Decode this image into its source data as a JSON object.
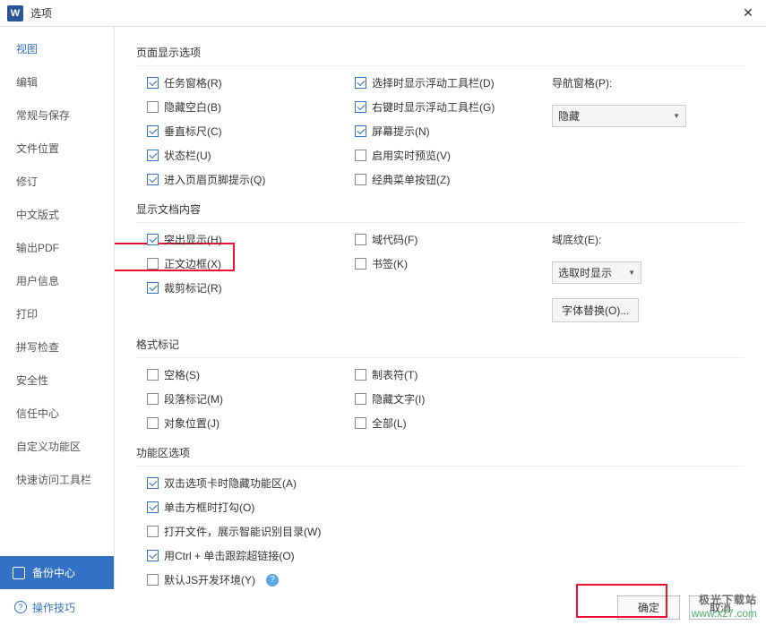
{
  "titlebar": {
    "icon": "W",
    "title": "选项",
    "close": "✕"
  },
  "sidebar": {
    "items": [
      "视图",
      "编辑",
      "常规与保存",
      "文件位置",
      "修订",
      "中文版式",
      "输出PDF",
      "用户信息",
      "打印",
      "拼写检查",
      "安全性",
      "信任中心",
      "自定义功能区",
      "快速访问工具栏"
    ],
    "backup": "备份中心"
  },
  "sections": {
    "page_display": {
      "title": "页面显示选项",
      "col1": [
        {
          "label": "任务窗格(R)",
          "checked": true
        },
        {
          "label": "隐藏空白(B)",
          "checked": false
        },
        {
          "label": "垂直标尺(C)",
          "checked": true
        },
        {
          "label": "状态栏(U)",
          "checked": true
        },
        {
          "label": "进入页眉页脚提示(Q)",
          "checked": true
        }
      ],
      "col2": [
        {
          "label": "选择时显示浮动工具栏(D)",
          "checked": true
        },
        {
          "label": "右键时显示浮动工具栏(G)",
          "checked": true
        },
        {
          "label": "屏幕提示(N)",
          "checked": true
        },
        {
          "label": "启用实时预览(V)",
          "checked": false
        },
        {
          "label": "经典菜单按钮(Z)",
          "checked": false
        }
      ],
      "nav_label": "导航窗格(P):",
      "nav_value": "隐藏"
    },
    "doc_content": {
      "title": "显示文档内容",
      "col1": [
        {
          "label": "突出显示(H)",
          "checked": true
        },
        {
          "label": "正文边框(X)",
          "checked": false
        },
        {
          "label": "裁剪标记(R)",
          "checked": true
        }
      ],
      "col2": [
        {
          "label": "域代码(F)",
          "checked": false
        },
        {
          "label": "书签(K)",
          "checked": false
        }
      ],
      "shade_label": "域底纹(E):",
      "shade_value": "选取时显示",
      "font_btn": "字体替换(O)..."
    },
    "format_marks": {
      "title": "格式标记",
      "col1": [
        {
          "label": "空格(S)",
          "checked": false
        },
        {
          "label": "段落标记(M)",
          "checked": false
        },
        {
          "label": "对象位置(J)",
          "checked": false
        }
      ],
      "col2": [
        {
          "label": "制表符(T)",
          "checked": false
        },
        {
          "label": "隐藏文字(I)",
          "checked": false
        },
        {
          "label": "全部(L)",
          "checked": false
        }
      ]
    },
    "ribbon": {
      "title": "功能区选项",
      "items": [
        {
          "label": "双击选项卡时隐藏功能区(A)",
          "checked": true
        },
        {
          "label": "单击方框时打勾(O)",
          "checked": true
        },
        {
          "label": "打开文件，展示智能识别目录(W)",
          "checked": false
        },
        {
          "label": "用Ctrl + 单击跟踪超链接(O)",
          "checked": true
        },
        {
          "label": "默认JS开发环境(Y)",
          "checked": false,
          "help": true
        }
      ]
    }
  },
  "footer": {
    "tips": "操作技巧",
    "ok": "确定",
    "cancel": "取消"
  },
  "watermark": {
    "l1": "极光下载站",
    "l2": "www.xz7.com"
  }
}
